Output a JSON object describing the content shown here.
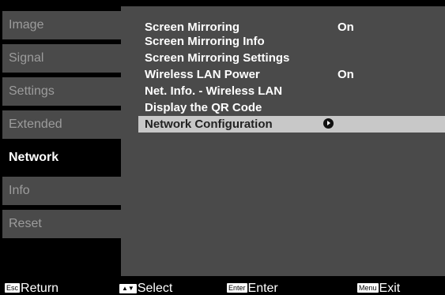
{
  "sidebar": {
    "items": [
      {
        "label": "Image"
      },
      {
        "label": "Signal"
      },
      {
        "label": "Settings"
      },
      {
        "label": "Extended"
      },
      {
        "label": "Network",
        "active": true
      },
      {
        "label": "Info"
      },
      {
        "label": "Reset"
      }
    ]
  },
  "menu": {
    "items": [
      {
        "label": "Screen Mirroring",
        "value": "On"
      },
      {
        "label": "Screen Mirroring Info"
      },
      {
        "label": "Screen Mirroring Settings"
      },
      {
        "label": "Wireless LAN Power",
        "value": "On"
      },
      {
        "label": "Net. Info. - Wireless LAN"
      },
      {
        "label": "Display the QR Code"
      },
      {
        "label": "Network Configuration",
        "selected": true,
        "icon": "submenu-arrow-icon"
      }
    ]
  },
  "footer": {
    "return_key": "Esc",
    "return_label": "Return",
    "select_key": "▲▼",
    "select_label": "Select",
    "enter_key": "Enter",
    "enter_label": "Enter",
    "menu_key": "Menu",
    "exit_label": "Exit"
  },
  "colors": {
    "background": "#000000",
    "panel": "#4a4a4a",
    "selected_row": "#c8c8c8",
    "inactive_text": "#9c9c9c"
  }
}
